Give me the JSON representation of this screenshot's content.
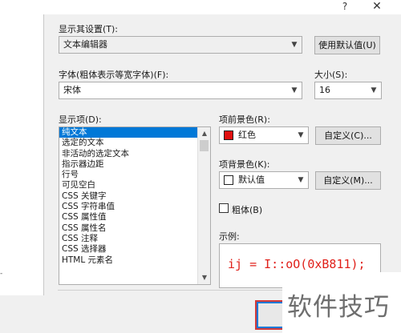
{
  "titlebar": {
    "help": "?",
    "close": "✕"
  },
  "display_settings": {
    "label": "显示其设置(T):",
    "value": "文本编辑器",
    "reset_button": "使用默认值(U)"
  },
  "font": {
    "label": "字体(粗体表示等宽字体)(F):",
    "value": "宋体"
  },
  "size": {
    "label": "大小(S):",
    "value": "16"
  },
  "display_items": {
    "label": "显示项(D):",
    "items": [
      "纯文本",
      "选定的文本",
      "非活动的选定文本",
      "指示器边距",
      "行号",
      "可见空白",
      "CSS 关键字",
      "CSS 字符串值",
      "CSS 属性值",
      "CSS 属性名",
      "CSS 注释",
      "CSS 选择器",
      "HTML 元素名"
    ],
    "selected_index": 0
  },
  "foreground": {
    "label": "项前景色(R):",
    "value": "红色",
    "swatch_color": "#e01010",
    "custom_button": "自定义(C)..."
  },
  "background": {
    "label": "项背景色(K):",
    "value": "默认值",
    "swatch_color": "#ffffff",
    "custom_button": "自定义(M)..."
  },
  "bold": {
    "label": "粗体(B)",
    "checked": false
  },
  "sample": {
    "label": "示例:",
    "text": "ij = I::oO(0xB811);"
  },
  "watermark": {
    "text": "软件技巧"
  },
  "left_panel": {
    "tick": "-"
  }
}
